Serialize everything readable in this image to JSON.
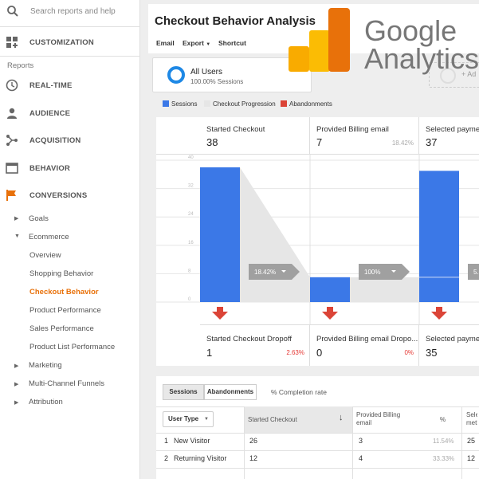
{
  "sidebar": {
    "search_placeholder": "Search reports and help",
    "customization": "CUSTOMIZATION",
    "reports_heading": "Reports",
    "sections": [
      {
        "label": "REAL-TIME",
        "icon": "clock-icon"
      },
      {
        "label": "AUDIENCE",
        "icon": "person-icon"
      },
      {
        "label": "ACQUISITION",
        "icon": "acquisition-icon"
      },
      {
        "label": "BEHAVIOR",
        "icon": "behavior-icon"
      },
      {
        "label": "CONVERSIONS",
        "icon": "flag-icon"
      }
    ],
    "conversions_items": {
      "goals": "Goals",
      "ecommerce": "Ecommerce",
      "overview": "Overview",
      "shopping_behavior": "Shopping Behavior",
      "checkout_behavior": "Checkout Behavior",
      "product_performance": "Product Performance",
      "sales_performance": "Sales Performance",
      "product_list_performance": "Product List Performance",
      "marketing": "Marketing",
      "multi_channel": "Multi-Channel Funnels",
      "attribution": "Attribution"
    },
    "active_color": "#e8710a"
  },
  "header": {
    "title": "Checkout Behavior Analysis",
    "email": "Email",
    "export": "Export",
    "shortcut": "Shortcut"
  },
  "segment": {
    "name": "All Users",
    "sessions_pct": "100.00% Sessions",
    "add_label": "+ Ad"
  },
  "legend": {
    "sessions": "Sessions",
    "checkout_progression": "Checkout Progression",
    "abandonments": "Abandonments",
    "sessions_color": "#3b78e7",
    "progression_color": "#e6e6e6",
    "abandon_color": "#db4437"
  },
  "chart_data": {
    "type": "bar",
    "categories": [
      "Started Checkout",
      "Provided Billing email",
      "Selected payme"
    ],
    "values": [
      38,
      7,
      37
    ],
    "ylim": [
      0,
      40
    ],
    "yticks": [
      "40",
      "32",
      "24",
      "16",
      "8",
      "0"
    ],
    "continuing": [
      7,
      7,
      7
    ],
    "conversion_labels": [
      "18.42%",
      "100%",
      "5."
    ]
  },
  "steps": [
    {
      "name": "Started Checkout",
      "value": "38",
      "pct": ""
    },
    {
      "name": "Provided Billing email",
      "value": "7",
      "pct": "18.42%"
    },
    {
      "name": "Selected payme",
      "value": "37",
      "pct": ""
    }
  ],
  "dropoffs": [
    {
      "name": "Started Checkout Dropoff",
      "value": "1",
      "pct": "2.63%"
    },
    {
      "name": "Provided Billing email Dropo...",
      "value": "0",
      "pct": "0%"
    },
    {
      "name": "Selected payme",
      "value": "35",
      "pct": ""
    }
  ],
  "table": {
    "tab_sessions": "Sessions",
    "tab_abandonments": "Abandonments",
    "tab_completion": "% Completion rate",
    "dim_select": "User Type",
    "col_started": "Started Checkout",
    "col_billing": "Provided Billing email",
    "col_pct": "%",
    "col_selected": "Sele meth",
    "rows": [
      {
        "idx": "1",
        "type": "New Visitor",
        "started": "26",
        "billing": "3",
        "pct": "11.54%",
        "selected": "25"
      },
      {
        "idx": "2",
        "type": "Returning Visitor",
        "started": "12",
        "billing": "4",
        "pct": "33.33%",
        "selected": "12"
      }
    ]
  },
  "logo": {
    "word1": "Google",
    "word2": "Analytics"
  }
}
